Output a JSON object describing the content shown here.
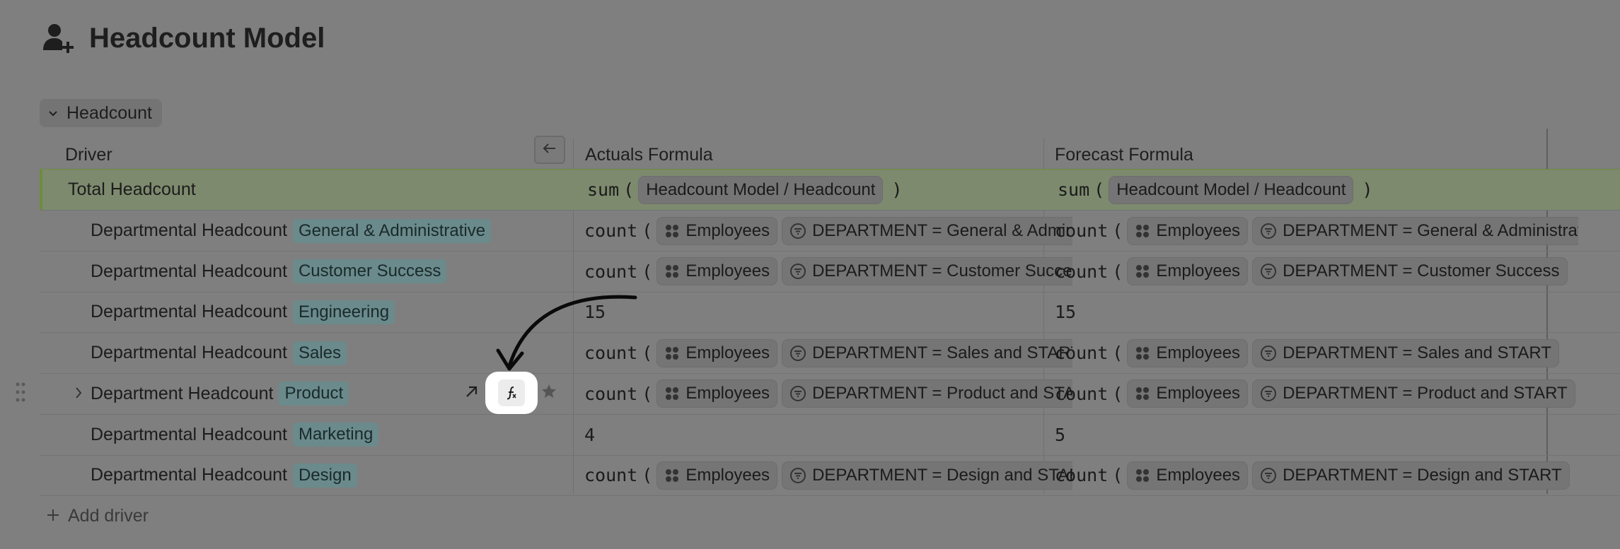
{
  "page": {
    "title": "Headcount Model"
  },
  "group": {
    "label": "Headcount"
  },
  "columns": {
    "driver": "Driver",
    "actuals": "Actuals Formula",
    "forecast": "Forecast Formula"
  },
  "total": {
    "label": "Total Headcount",
    "actuals": {
      "fn": "sum",
      "ref": "Headcount Model / Headcount"
    },
    "forecast": {
      "fn": "sum",
      "ref": "Headcount Model / Headcount"
    }
  },
  "rows": [
    {
      "label": "Departmental Headcount",
      "tag": "General & Administrative",
      "actuals": {
        "fn": "count",
        "source": "Employees",
        "filter": "DEPARTMENT = General & Administrative"
      },
      "forecast": {
        "fn": "count",
        "source": "Employees",
        "filter": "DEPARTMENT = General & Administrative"
      }
    },
    {
      "label": "Departmental Headcount",
      "tag": "Customer Success",
      "actuals": {
        "fn": "count",
        "source": "Employees",
        "filter": "DEPARTMENT = Customer Success"
      },
      "forecast": {
        "fn": "count",
        "source": "Employees",
        "filter": "DEPARTMENT = Customer Success"
      }
    },
    {
      "label": "Departmental Headcount",
      "tag": "Engineering",
      "actuals": {
        "value": "15"
      },
      "forecast": {
        "value": "15"
      }
    },
    {
      "label": "Departmental Headcount",
      "tag": "Sales",
      "actuals": {
        "fn": "count",
        "source": "Employees",
        "filter": "DEPARTMENT = Sales and START"
      },
      "forecast": {
        "fn": "count",
        "source": "Employees",
        "filter": "DEPARTMENT = Sales and START"
      }
    },
    {
      "label": "Department Headcount",
      "tag": "Product",
      "actuals": {
        "fn": "count",
        "source": "Employees",
        "filter": "DEPARTMENT = Product and START"
      },
      "forecast": {
        "fn": "count",
        "source": "Employees",
        "filter": "DEPARTMENT = Product and START"
      }
    },
    {
      "label": "Departmental Headcount",
      "tag": "Marketing",
      "actuals": {
        "value": "4"
      },
      "forecast": {
        "value": "5"
      }
    },
    {
      "label": "Departmental Headcount",
      "tag": "Design",
      "actuals": {
        "fn": "count",
        "source": "Employees",
        "filter": "DEPARTMENT = Design and START"
      },
      "forecast": {
        "fn": "count",
        "source": "Employees",
        "filter": "DEPARTMENT = Design and START"
      }
    }
  ],
  "add_driver": {
    "label": "Add driver"
  },
  "icons": {
    "page": "user-plus-icon",
    "group_toggle": "chevron-down-icon",
    "collapse": "arrow-left-icon",
    "source": "grid-dots-icon",
    "filter": "filter-icon",
    "formula": "formula-icon",
    "drag": "drag-handle-icon",
    "expand": "chevron-right-icon",
    "open": "arrow-up-right-icon",
    "favorite": "star-icon",
    "add": "plus-icon"
  },
  "colors": {
    "background": "#7f7f7f",
    "total_row": "#7d8a6e",
    "tag": "#6b8a8b",
    "highlight": "#ffffff"
  }
}
